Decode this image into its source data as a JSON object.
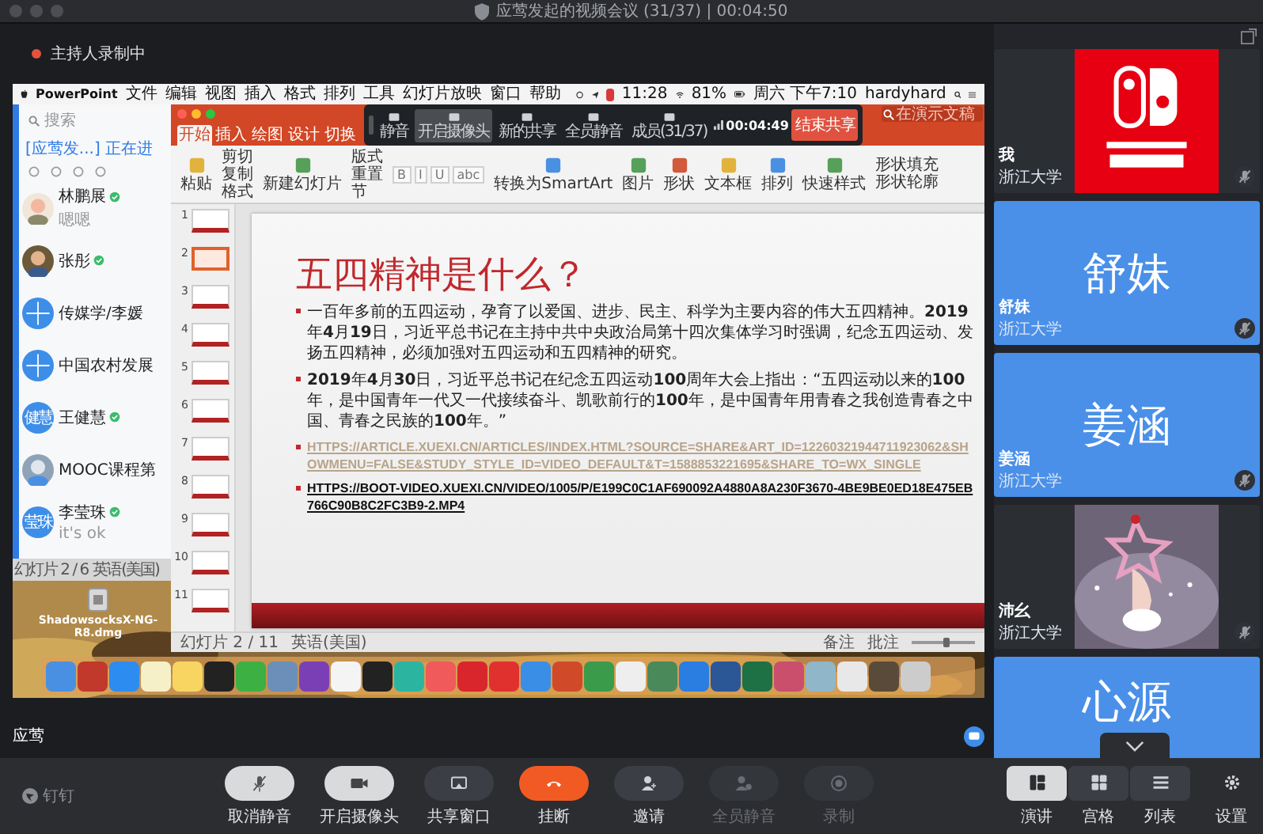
{
  "window": {
    "title": "应莺发起的视频会议 (31/37) | 00:04:50"
  },
  "recording_notice": "主持人录制中",
  "shared_screen": {
    "menubar": {
      "app": "PowerPoint",
      "menus": [
        "文件",
        "编辑",
        "视图",
        "插入",
        "格式",
        "排列",
        "工具",
        "幻灯片放映",
        "窗口",
        "帮助"
      ],
      "clock": "11:28",
      "battery": "81%",
      "datetime": "周六 下午7:10",
      "user": "hardyhard"
    },
    "chat_app": {
      "search_placeholder": "搜索",
      "banner": "[应莺发...] 正在进",
      "contacts": [
        {
          "name": "林鹏展",
          "verified": true,
          "preview": "嗯嗯"
        },
        {
          "name": "张彤",
          "verified": true
        },
        {
          "name": "传媒学/李媛",
          "verified": false,
          "avatar": {
            "kind": "group"
          }
        },
        {
          "name": "中国农村发展",
          "verified": false,
          "avatar": {
            "kind": "group"
          }
        },
        {
          "name": "王健慧",
          "verified": true,
          "avatar": {
            "kind": "text",
            "text": "健慧"
          }
        },
        {
          "name": "MOOC课程第",
          "verified": false
        },
        {
          "name": "李莹珠",
          "verified": true,
          "preview": "it's ok",
          "avatar": {
            "kind": "text",
            "text": "莹珠"
          }
        }
      ]
    },
    "powerpoint": {
      "search_placeholder": "在演示文稿",
      "tabs": [
        {
          "label": "开始",
          "selected": true
        },
        {
          "label": "插入",
          "selected": false
        },
        {
          "label": "绘图",
          "selected": false
        },
        {
          "label": "设计",
          "selected": false
        },
        {
          "label": "切换",
          "selected": false
        }
      ],
      "ribbon": [
        {
          "kind": "large",
          "label": "粘贴"
        },
        {
          "kind": "stack",
          "items": [
            "剪切",
            "复制",
            "格式"
          ]
        },
        {
          "kind": "large",
          "label": "新建幻灯片"
        },
        {
          "kind": "stack",
          "items": [
            "版式",
            "重置",
            "节"
          ]
        },
        {
          "kind": "format",
          "items": [
            "B",
            "I",
            "U",
            "abc"
          ]
        },
        {
          "kind": "large",
          "label": "转换为SmartArt"
        },
        {
          "kind": "large",
          "label": "图片"
        },
        {
          "kind": "large",
          "label": "形状"
        },
        {
          "kind": "large",
          "label": "文本框"
        },
        {
          "kind": "large",
          "label": "排列"
        },
        {
          "kind": "large",
          "label": "快速样式"
        },
        {
          "kind": "stack",
          "items": [
            "形状填充",
            "形状轮廓"
          ]
        }
      ],
      "slides": [
        {
          "number": "1",
          "selected": false
        },
        {
          "number": "2",
          "selected": true
        },
        {
          "number": "3",
          "selected": false
        },
        {
          "number": "4",
          "selected": false
        },
        {
          "number": "5",
          "selected": false
        },
        {
          "number": "6",
          "selected": false
        },
        {
          "number": "7",
          "selected": false
        },
        {
          "number": "8",
          "selected": false
        },
        {
          "number": "9",
          "selected": false
        },
        {
          "number": "10",
          "selected": false
        },
        {
          "number": "11",
          "selected": false
        }
      ],
      "slide": {
        "title": "五四精神是什么？",
        "bullets": [
          {
            "kind": "text",
            "text": "一百年多前的五四运动，孕育了以爱国、进步、民主、科学为主要内容的伟大五四精神。**2019**年**4**月**19**日，习近平总书记在主持中共中央政治局第十四次集体学习时强调，纪念五四运动、发扬五四精神，必须加强对五四运动和五四精神的研究。"
          },
          {
            "kind": "text",
            "text": "**2019**年**4**月**30**日，习近平总书记在纪念五四运动**100**周年大会上指出：“五四运动以来的**100**年，是中国青年一代又一代接续奋斗、凯歌前行的**100**年，是中国青年用青春之我创造青春之中国、青春之民族的**100**年。”"
          },
          {
            "kind": "link",
            "visited": true,
            "text": "HTTPS://ARTICLE.XUEXI.CN/ARTICLES/INDEX.HTML?SOURCE=SHARE&ART_ID=12260321944711923062&SHOWMENU=FALSE&STUDY_STYLE_ID=VIDEO_DEFAULT&T=1588853221695&SHARE_TO=WX_SINGLE"
          },
          {
            "kind": "link",
            "visited": false,
            "text": "HTTPS://BOOT-VIDEO.XUEXI.CN/VIDEO/1005/P/E199C0C1AF690092A4880A8A230F3670-4BE9BE0ED18E475EB766C90B8C2FC3B9-2.MP4"
          }
        ]
      },
      "status": {
        "position": "幻灯片 2 / 11",
        "language": "英语(美国)",
        "notes": "备注",
        "comments": "批注",
        "zoom": {
          "level": 0.55
        }
      }
    },
    "share_toolbar": {
      "buttons": [
        {
          "label": "静音",
          "selected": false
        },
        {
          "label": "开启摄像头",
          "selected": true
        },
        {
          "label": "新的共享",
          "selected": false
        },
        {
          "label": "全员静音",
          "selected": false
        },
        {
          "label": "成员(31/37)",
          "selected": false
        }
      ],
      "timer": "00:04:49",
      "stop_label": "结束共享"
    },
    "back_window_status": {
      "position": "幻灯片 2 / 6",
      "language": "英语(美国)"
    },
    "desktop_file": "ShadowsocksX-NG-R8.dmg"
  },
  "presenter": "应莺",
  "participants": [
    {
      "name": "我",
      "org": "浙江大学",
      "muted": true
    },
    {
      "name": "舒妹",
      "org": "浙江大学",
      "muted": true,
      "avatar": {
        "kind": "text",
        "text": "舒妹"
      }
    },
    {
      "name": "姜涵",
      "org": "浙江大学",
      "muted": true,
      "avatar": {
        "kind": "text",
        "text": "姜涵"
      }
    },
    {
      "name": "沛幺",
      "org": "浙江大学",
      "muted": true
    },
    {
      "avatar": {
        "kind": "text",
        "text": "心源"
      }
    }
  ],
  "view_modes": [
    {
      "label": "演讲",
      "selected": true
    },
    {
      "label": "宫格",
      "selected": false
    },
    {
      "label": "列表",
      "selected": false
    }
  ],
  "settings_label": "设置",
  "brand": "钉钉",
  "controls": [
    {
      "label": "取消静音",
      "kind": "light",
      "disabled": false
    },
    {
      "label": "开启摄像头",
      "kind": "light",
      "disabled": false
    },
    {
      "label": "共享窗口",
      "kind": "dark",
      "disabled": false
    },
    {
      "label": "挂断",
      "kind": "hangup",
      "disabled": false
    },
    {
      "label": "邀请",
      "kind": "dark",
      "disabled": false
    },
    {
      "label": "全员静音",
      "kind": "dark",
      "disabled": true
    },
    {
      "label": "录制",
      "kind": "dark",
      "disabled": true
    }
  ]
}
